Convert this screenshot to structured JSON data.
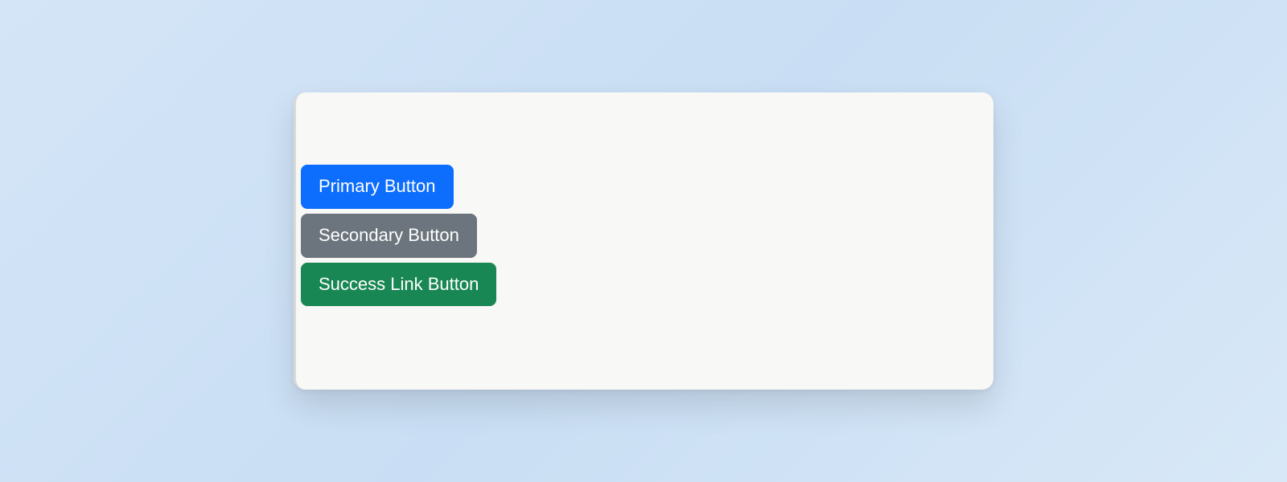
{
  "buttons": {
    "primary": {
      "label": "Primary Button",
      "color": "#0d6efd"
    },
    "secondary": {
      "label": "Secondary Button",
      "color": "#6c757d"
    },
    "success": {
      "label": "Success Link Button",
      "color": "#198754"
    }
  }
}
